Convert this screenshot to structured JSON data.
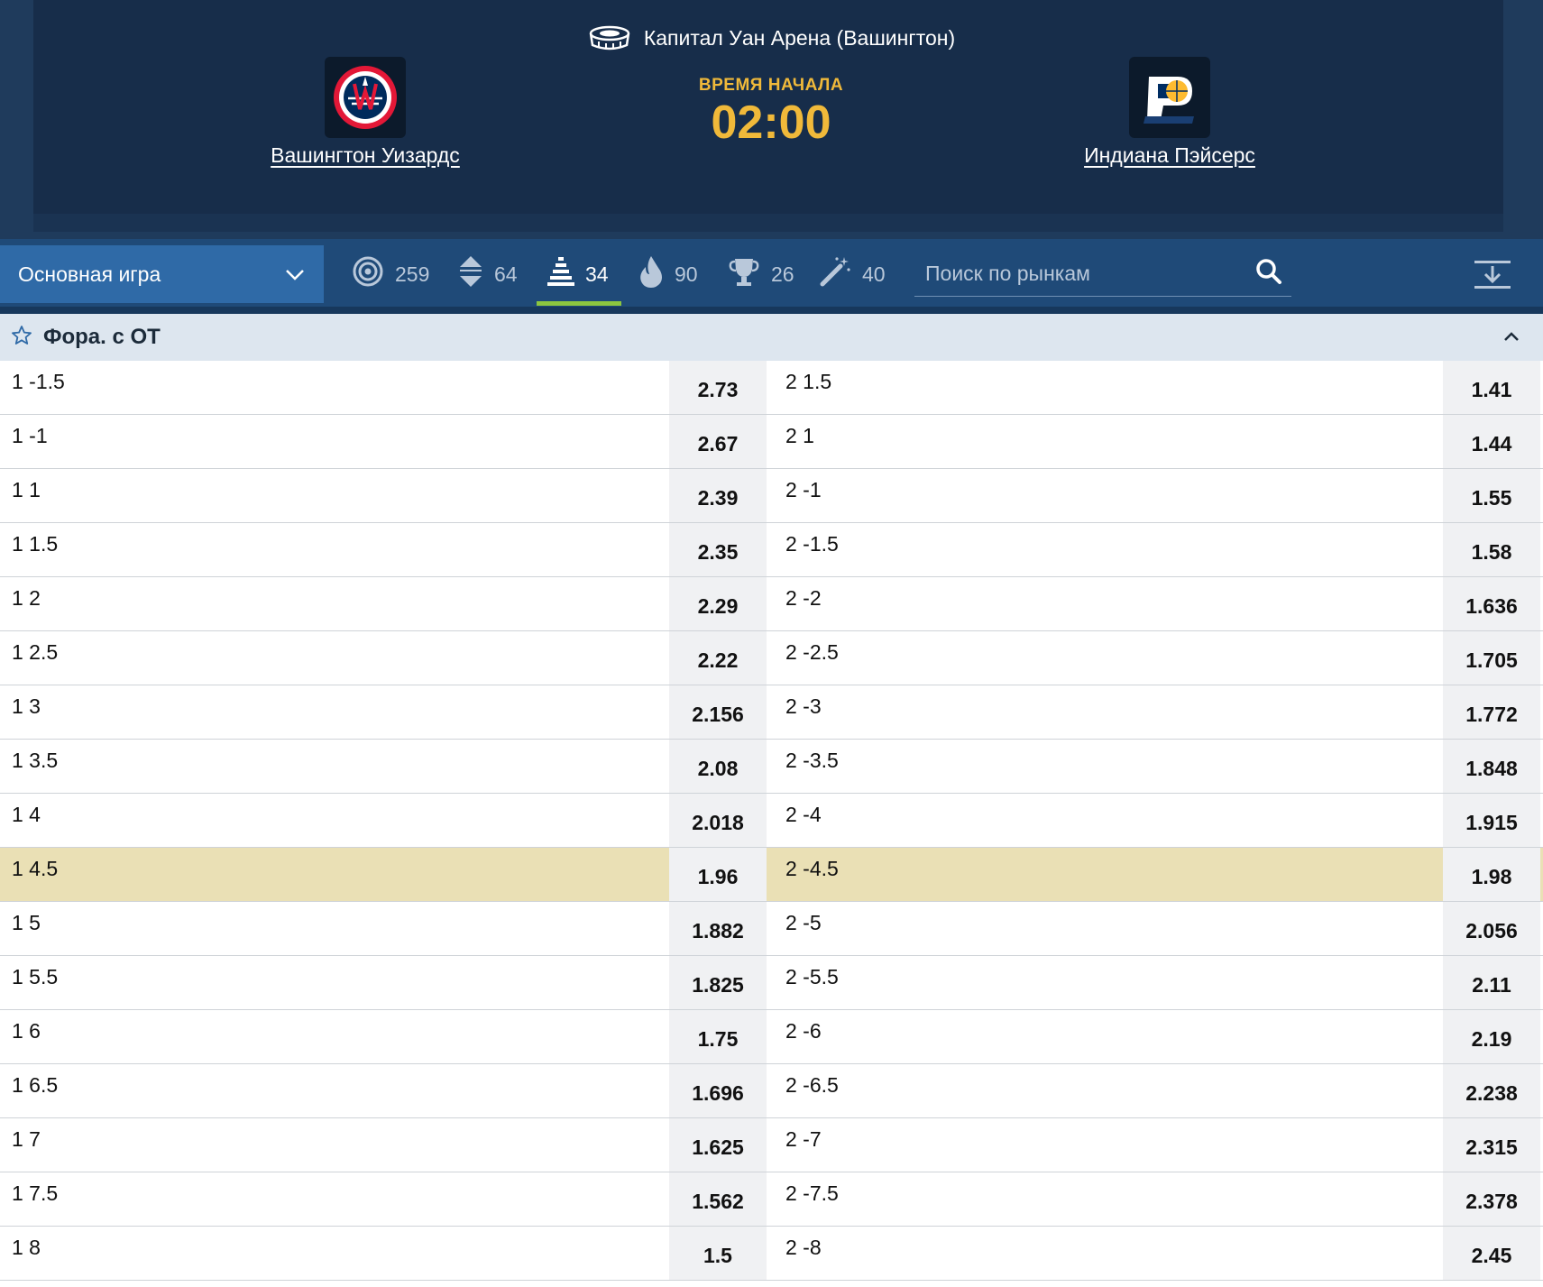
{
  "event": {
    "venue": "Капитал Уан Арена (Вашингтон)",
    "start_label": "ВРЕМЯ НАЧАЛА",
    "start_time": "02:00",
    "home_team": "Вашингтон Уизардс",
    "away_team": "Индиана Пэйсерс",
    "home_logo_text": "WASHINGTON WIZARDS",
    "away_logo_text": "Pacers"
  },
  "toolbar": {
    "market_select": "Основная игра",
    "tabs": [
      {
        "icon": "target-icon",
        "count": "259"
      },
      {
        "icon": "updown-icon",
        "count": "64"
      },
      {
        "icon": "bars-icon",
        "count": "34",
        "active": true
      },
      {
        "icon": "fire-icon",
        "count": "90"
      },
      {
        "icon": "trophy-icon",
        "count": "26"
      },
      {
        "icon": "magic-wand-icon",
        "count": "40"
      }
    ],
    "search_placeholder": "Поиск по рынкам"
  },
  "market": {
    "title": "Фора. с ОТ",
    "rows": [
      {
        "l": "1 -1.5",
        "lo": "2.73",
        "r": "2 1.5",
        "ro": "1.41"
      },
      {
        "l": "1 -1",
        "lo": "2.67",
        "r": "2 1",
        "ro": "1.44"
      },
      {
        "l": "1 1",
        "lo": "2.39",
        "r": "2 -1",
        "ro": "1.55"
      },
      {
        "l": "1 1.5",
        "lo": "2.35",
        "r": "2 -1.5",
        "ro": "1.58"
      },
      {
        "l": "1 2",
        "lo": "2.29",
        "r": "2 -2",
        "ro": "1.636"
      },
      {
        "l": "1 2.5",
        "lo": "2.22",
        "r": "2 -2.5",
        "ro": "1.705"
      },
      {
        "l": "1 3",
        "lo": "2.156",
        "r": "2 -3",
        "ro": "1.772"
      },
      {
        "l": "1 3.5",
        "lo": "2.08",
        "r": "2 -3.5",
        "ro": "1.848"
      },
      {
        "l": "1 4",
        "lo": "2.018",
        "r": "2 -4",
        "ro": "1.915"
      },
      {
        "l": "1 4.5",
        "lo": "1.96",
        "r": "2 -4.5",
        "ro": "1.98",
        "highlight": true
      },
      {
        "l": "1 5",
        "lo": "1.882",
        "r": "2 -5",
        "ro": "2.056"
      },
      {
        "l": "1 5.5",
        "lo": "1.825",
        "r": "2 -5.5",
        "ro": "2.11"
      },
      {
        "l": "1 6",
        "lo": "1.75",
        "r": "2 -6",
        "ro": "2.19"
      },
      {
        "l": "1 6.5",
        "lo": "1.696",
        "r": "2 -6.5",
        "ro": "2.238"
      },
      {
        "l": "1 7",
        "lo": "1.625",
        "r": "2 -7",
        "ro": "2.315"
      },
      {
        "l": "1 7.5",
        "lo": "1.562",
        "r": "2 -7.5",
        "ro": "2.378"
      },
      {
        "l": "1 8",
        "lo": "1.5",
        "r": "2 -8",
        "ro": "2.45"
      }
    ]
  },
  "colors": {
    "header_bg": "#172d4a",
    "accent_time": "#f0b93a",
    "toolbar_bg": "#1f4a78",
    "active_underline": "#8cc63f",
    "highlight_row": "#eae0b5"
  }
}
